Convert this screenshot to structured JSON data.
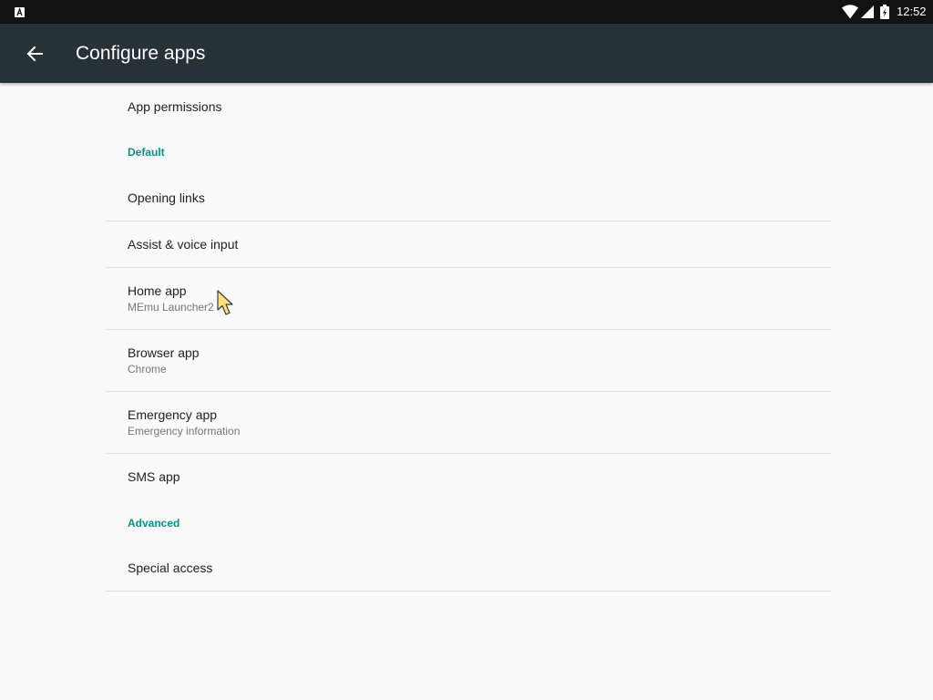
{
  "status_bar": {
    "time": "12:52",
    "icons": [
      "notification-a-icon",
      "wifi-icon",
      "signal-icon",
      "battery-icon"
    ]
  },
  "app_bar": {
    "title": "Configure apps",
    "back_icon": "arrow-back-icon"
  },
  "items": {
    "app_permissions": {
      "title": "App permissions"
    },
    "default_header": "Default",
    "opening_links": {
      "title": "Opening links"
    },
    "assist_voice": {
      "title": "Assist & voice input"
    },
    "home_app": {
      "title": "Home app",
      "summary": "MEmu Launcher2"
    },
    "browser_app": {
      "title": "Browser app",
      "summary": "Chrome"
    },
    "emergency_app": {
      "title": "Emergency app",
      "summary": "Emergency information"
    },
    "sms_app": {
      "title": "SMS app"
    },
    "advanced_header": "Advanced",
    "special_access": {
      "title": "Special access"
    }
  },
  "colors": {
    "app_bar": "#263238",
    "status_bar": "#121212",
    "accent": "#009688",
    "background": "#fafafa",
    "divider": "#e0e0e0"
  }
}
